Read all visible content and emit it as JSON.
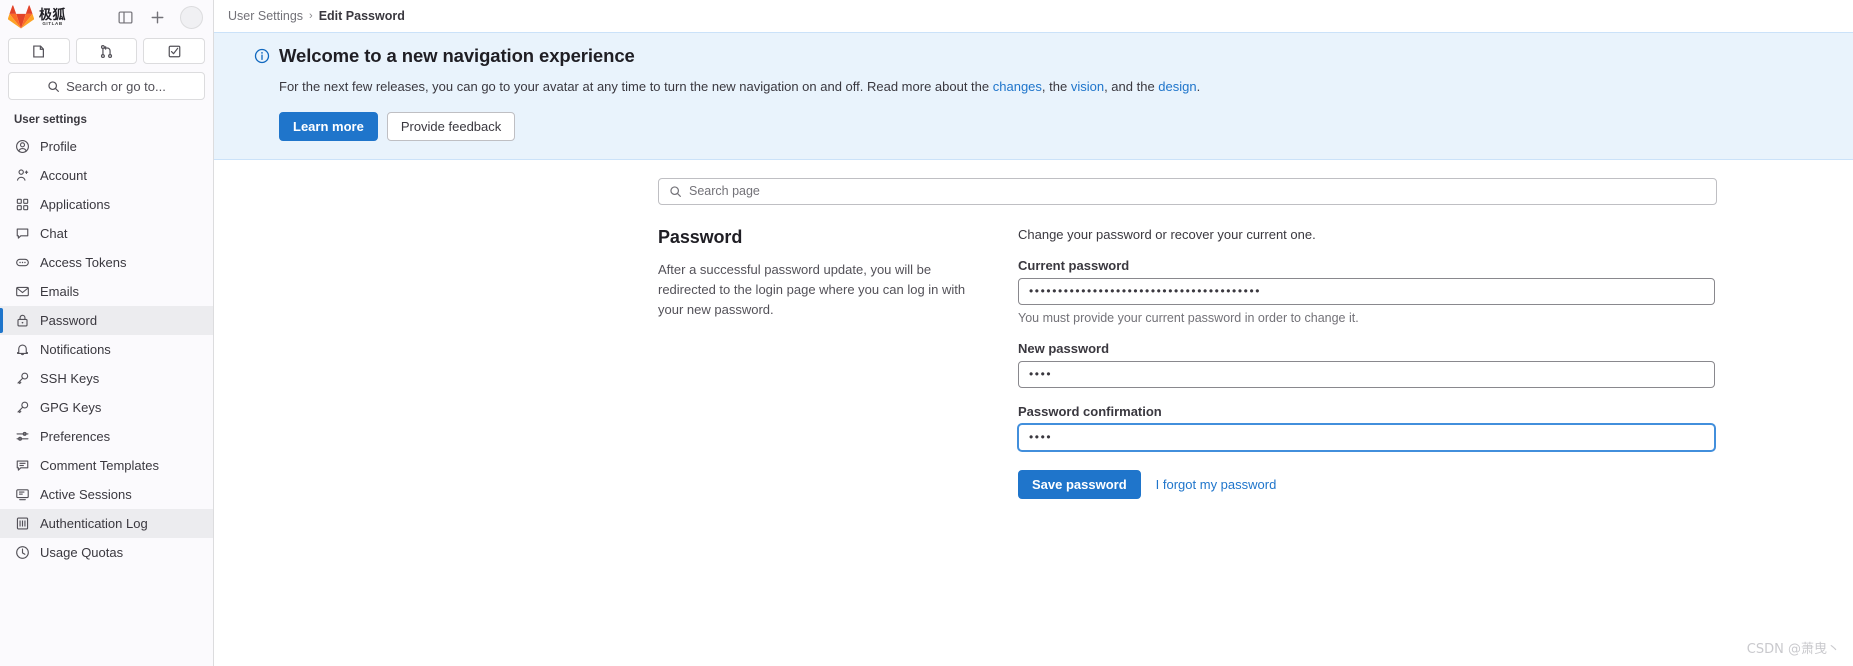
{
  "sidebar": {
    "brand": {
      "cn_name": "极狐",
      "sub_name": "GITLAB",
      "logo_icon": "gitlab-fox-logo"
    },
    "top_actions": [
      {
        "name": "toggle-sidebar-button",
        "icon": "panel-toggle-icon"
      },
      {
        "name": "create-new-button",
        "icon": "plus-icon"
      },
      {
        "name": "user-avatar",
        "icon": "avatar-icon"
      }
    ],
    "tabs": [
      {
        "name": "issues-tab",
        "icon": "issue-icon"
      },
      {
        "name": "merge-requests-tab",
        "icon": "merge-request-icon"
      },
      {
        "name": "todos-tab",
        "icon": "todo-check-icon"
      }
    ],
    "search": {
      "label": "Search or go to...",
      "icon": "search-icon"
    },
    "section_title": "User settings",
    "items": [
      {
        "label": "Profile",
        "icon": "profile-icon",
        "state": "default"
      },
      {
        "label": "Account",
        "icon": "account-icon",
        "state": "default"
      },
      {
        "label": "Applications",
        "icon": "applications-grid-icon",
        "state": "default"
      },
      {
        "label": "Chat",
        "icon": "chat-bubble-icon",
        "state": "default"
      },
      {
        "label": "Access Tokens",
        "icon": "token-icon",
        "state": "default"
      },
      {
        "label": "Emails",
        "icon": "envelope-icon",
        "state": "default"
      },
      {
        "label": "Password",
        "icon": "lock-icon",
        "state": "active"
      },
      {
        "label": "Notifications",
        "icon": "bell-icon",
        "state": "default"
      },
      {
        "label": "SSH Keys",
        "icon": "key-icon",
        "state": "default"
      },
      {
        "label": "GPG Keys",
        "icon": "key-icon",
        "state": "default"
      },
      {
        "label": "Preferences",
        "icon": "sliders-icon",
        "state": "default"
      },
      {
        "label": "Comment Templates",
        "icon": "comment-lines-icon",
        "state": "default"
      },
      {
        "label": "Active Sessions",
        "icon": "monitor-icon",
        "state": "default"
      },
      {
        "label": "Authentication Log",
        "icon": "log-list-icon",
        "state": "highlight"
      },
      {
        "label": "Usage Quotas",
        "icon": "quota-clock-icon",
        "state": "default"
      }
    ]
  },
  "breadcrumb": {
    "parent": "User Settings",
    "separator": "›",
    "current": "Edit Password"
  },
  "banner": {
    "icon": "info-circle-icon",
    "title": "Welcome to a new navigation experience",
    "desc_part1": "For the next few releases, you can go to your avatar at any time to turn the new navigation on and off. Read more about the ",
    "link_changes": "changes",
    "desc_part2": ", the ",
    "link_vision": "vision",
    "desc_part3": ", and the ",
    "link_design": "design",
    "desc_part4": ".",
    "learn_more_label": "Learn more",
    "feedback_label": "Provide feedback"
  },
  "search_page": {
    "placeholder": "Search page",
    "icon": "search-icon",
    "value": ""
  },
  "password_section": {
    "heading": "Password",
    "description": "After a successful password update, you will be redirected to the login page where you can log in with your new password.",
    "form_intro": "Change your password or recover your current one.",
    "current_password": {
      "label": "Current password",
      "value": "••••••••••••••••••••••••••••••••••••••••",
      "help": "You must provide your current password in order to change it."
    },
    "new_password": {
      "label": "New password",
      "value": "••••"
    },
    "password_confirmation": {
      "label": "Password confirmation",
      "value": "••••",
      "focused": true
    },
    "save_label": "Save password",
    "forgot_label": "I forgot my password"
  },
  "watermark": "CSDN @萧曳丶",
  "colors": {
    "accent": "#1f75cb",
    "banner_bg": "#e9f3fc",
    "sidebar_bg": "#fbfafd",
    "active_item_bg": "#ececef"
  }
}
